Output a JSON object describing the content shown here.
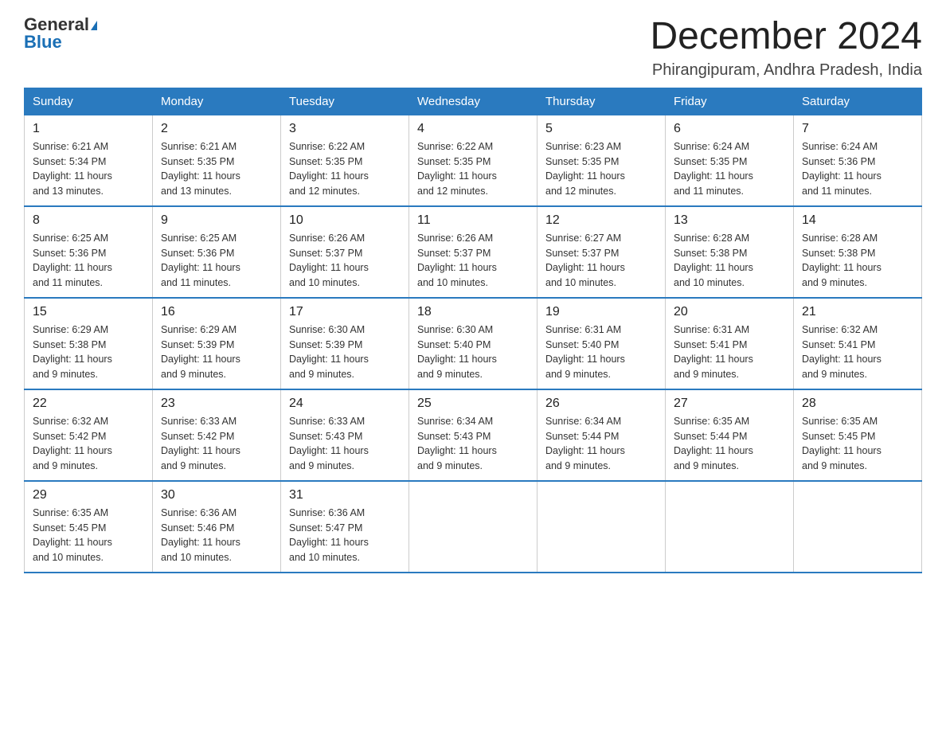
{
  "logo": {
    "general": "General",
    "blue": "Blue"
  },
  "title": "December 2024",
  "location": "Phirangipuram, Andhra Pradesh, India",
  "weekdays": [
    "Sunday",
    "Monday",
    "Tuesday",
    "Wednesday",
    "Thursday",
    "Friday",
    "Saturday"
  ],
  "weeks": [
    [
      {
        "day": "1",
        "sunrise": "6:21 AM",
        "sunset": "5:34 PM",
        "daylight": "11 hours and 13 minutes."
      },
      {
        "day": "2",
        "sunrise": "6:21 AM",
        "sunset": "5:35 PM",
        "daylight": "11 hours and 13 minutes."
      },
      {
        "day": "3",
        "sunrise": "6:22 AM",
        "sunset": "5:35 PM",
        "daylight": "11 hours and 12 minutes."
      },
      {
        "day": "4",
        "sunrise": "6:22 AM",
        "sunset": "5:35 PM",
        "daylight": "11 hours and 12 minutes."
      },
      {
        "day": "5",
        "sunrise": "6:23 AM",
        "sunset": "5:35 PM",
        "daylight": "11 hours and 12 minutes."
      },
      {
        "day": "6",
        "sunrise": "6:24 AM",
        "sunset": "5:35 PM",
        "daylight": "11 hours and 11 minutes."
      },
      {
        "day": "7",
        "sunrise": "6:24 AM",
        "sunset": "5:36 PM",
        "daylight": "11 hours and 11 minutes."
      }
    ],
    [
      {
        "day": "8",
        "sunrise": "6:25 AM",
        "sunset": "5:36 PM",
        "daylight": "11 hours and 11 minutes."
      },
      {
        "day": "9",
        "sunrise": "6:25 AM",
        "sunset": "5:36 PM",
        "daylight": "11 hours and 11 minutes."
      },
      {
        "day": "10",
        "sunrise": "6:26 AM",
        "sunset": "5:37 PM",
        "daylight": "11 hours and 10 minutes."
      },
      {
        "day": "11",
        "sunrise": "6:26 AM",
        "sunset": "5:37 PM",
        "daylight": "11 hours and 10 minutes."
      },
      {
        "day": "12",
        "sunrise": "6:27 AM",
        "sunset": "5:37 PM",
        "daylight": "11 hours and 10 minutes."
      },
      {
        "day": "13",
        "sunrise": "6:28 AM",
        "sunset": "5:38 PM",
        "daylight": "11 hours and 10 minutes."
      },
      {
        "day": "14",
        "sunrise": "6:28 AM",
        "sunset": "5:38 PM",
        "daylight": "11 hours and 9 minutes."
      }
    ],
    [
      {
        "day": "15",
        "sunrise": "6:29 AM",
        "sunset": "5:38 PM",
        "daylight": "11 hours and 9 minutes."
      },
      {
        "day": "16",
        "sunrise": "6:29 AM",
        "sunset": "5:39 PM",
        "daylight": "11 hours and 9 minutes."
      },
      {
        "day": "17",
        "sunrise": "6:30 AM",
        "sunset": "5:39 PM",
        "daylight": "11 hours and 9 minutes."
      },
      {
        "day": "18",
        "sunrise": "6:30 AM",
        "sunset": "5:40 PM",
        "daylight": "11 hours and 9 minutes."
      },
      {
        "day": "19",
        "sunrise": "6:31 AM",
        "sunset": "5:40 PM",
        "daylight": "11 hours and 9 minutes."
      },
      {
        "day": "20",
        "sunrise": "6:31 AM",
        "sunset": "5:41 PM",
        "daylight": "11 hours and 9 minutes."
      },
      {
        "day": "21",
        "sunrise": "6:32 AM",
        "sunset": "5:41 PM",
        "daylight": "11 hours and 9 minutes."
      }
    ],
    [
      {
        "day": "22",
        "sunrise": "6:32 AM",
        "sunset": "5:42 PM",
        "daylight": "11 hours and 9 minutes."
      },
      {
        "day": "23",
        "sunrise": "6:33 AM",
        "sunset": "5:42 PM",
        "daylight": "11 hours and 9 minutes."
      },
      {
        "day": "24",
        "sunrise": "6:33 AM",
        "sunset": "5:43 PM",
        "daylight": "11 hours and 9 minutes."
      },
      {
        "day": "25",
        "sunrise": "6:34 AM",
        "sunset": "5:43 PM",
        "daylight": "11 hours and 9 minutes."
      },
      {
        "day": "26",
        "sunrise": "6:34 AM",
        "sunset": "5:44 PM",
        "daylight": "11 hours and 9 minutes."
      },
      {
        "day": "27",
        "sunrise": "6:35 AM",
        "sunset": "5:44 PM",
        "daylight": "11 hours and 9 minutes."
      },
      {
        "day": "28",
        "sunrise": "6:35 AM",
        "sunset": "5:45 PM",
        "daylight": "11 hours and 9 minutes."
      }
    ],
    [
      {
        "day": "29",
        "sunrise": "6:35 AM",
        "sunset": "5:45 PM",
        "daylight": "11 hours and 10 minutes."
      },
      {
        "day": "30",
        "sunrise": "6:36 AM",
        "sunset": "5:46 PM",
        "daylight": "11 hours and 10 minutes."
      },
      {
        "day": "31",
        "sunrise": "6:36 AM",
        "sunset": "5:47 PM",
        "daylight": "11 hours and 10 minutes."
      },
      null,
      null,
      null,
      null
    ]
  ],
  "labels": {
    "sunrise": "Sunrise:",
    "sunset": "Sunset:",
    "daylight": "Daylight:"
  }
}
